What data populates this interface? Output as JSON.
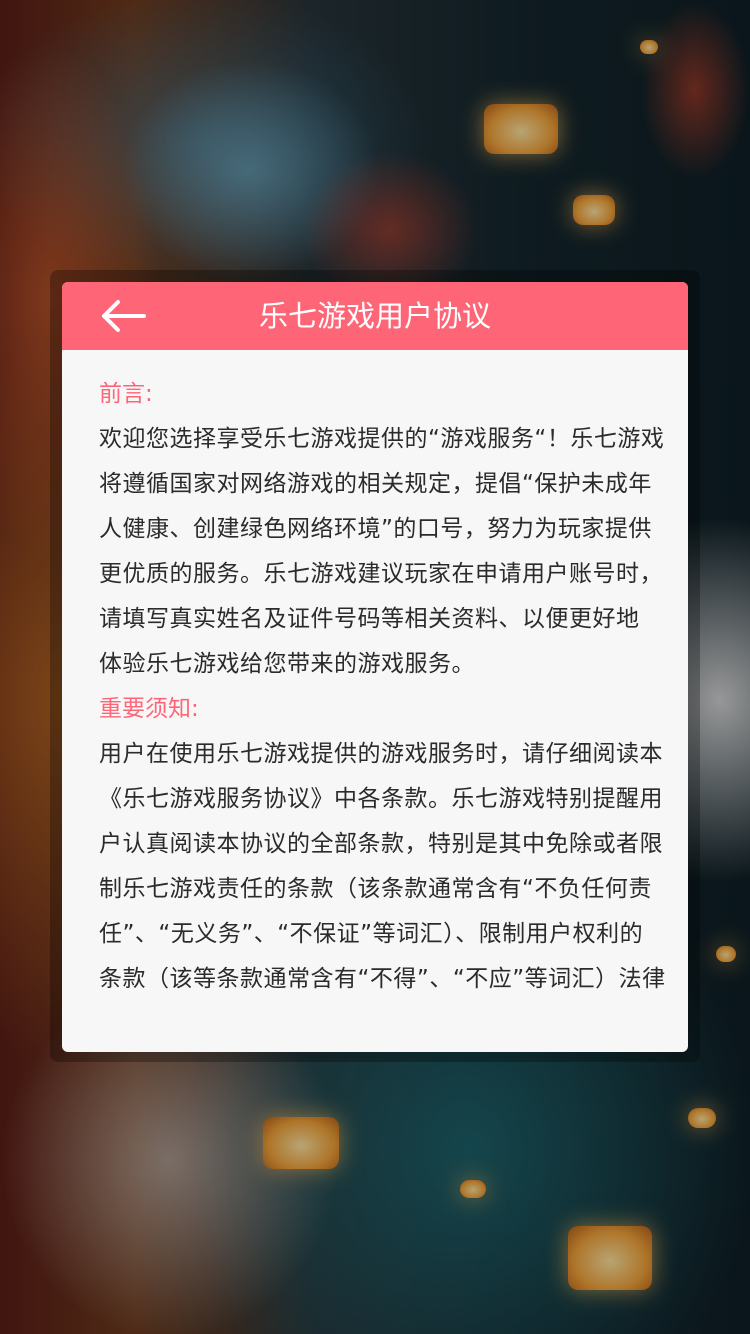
{
  "colors": {
    "accent": "#fe6677",
    "dialog_background": "#f7f7f7",
    "body_text": "#2b2b2b",
    "header_text": "#ffffff"
  },
  "dialog": {
    "title": "乐七游戏用户协议",
    "back_icon": "arrow-left-icon",
    "sections": [
      {
        "heading": "前言:",
        "lines": [
          "欢迎您选择享受乐七游戏提供的“游戏服务“！乐七游戏",
          "将遵循国家对网络游戏的相关规定，提倡“保护未成年",
          "人健康、创建绿色网络环境”的口号，努力为玩家提供",
          "更优质的服务。乐七游戏建议玩家在申请用户账号时，",
          "请填写真实姓名及证件号码等相关资料、以便更好地",
          "体验乐七游戏给您带来的游戏服务。"
        ]
      },
      {
        "heading": "重要须知:",
        "lines": [
          "用户在使用乐七游戏提供的游戏服务时，请仔细阅读本",
          "《乐七游戏服务协议》中各条款。乐七游戏特别提醒用",
          "户认真阅读本协议的全部条款，特别是其中免除或者限",
          "制乐七游戏责任的条款（该条款通常含有“不负任何责",
          "任”、“无义务”、“不保证”等词汇）、限制用户权利的",
          "条款（该等条款通常含有“不得”、“不应”等词汇）法律"
        ]
      }
    ]
  }
}
